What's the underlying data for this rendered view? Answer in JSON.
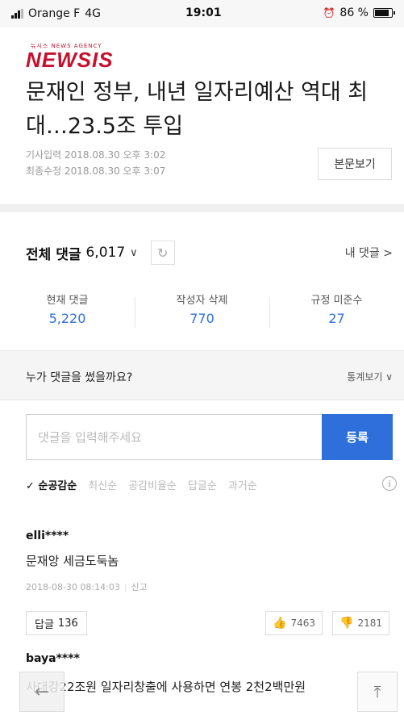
{
  "status_bar": {
    "carrier": "Orange F",
    "network": "4G",
    "time": "19:01",
    "alarm_icon": "alarm-clock-icon",
    "battery": "86 %",
    "battery_level": 0.86
  },
  "brand": {
    "logo_small": "뉴시스 NEWS AGENCY",
    "logo": "NEWSIS"
  },
  "article": {
    "headline": "문재인 정부, 내년 일자리예산 역대 최대…23.5조 투입",
    "published_label": "기사입력",
    "published": "2018.08.30 오후 3:02",
    "modified_label": "최종수정",
    "modified": "2018.08.30 오후 3:07",
    "original_button": "본문보기"
  },
  "comments_header": {
    "title": "전체 댓글",
    "count": "6,017",
    "dropdown_icon": "chevron-down-icon",
    "refresh_icon": "refresh-icon",
    "my_comments": "내 댓글 >"
  },
  "stats": [
    {
      "label": "현재 댓글",
      "value": "5,220"
    },
    {
      "label": "작성자 삭제",
      "value": "770"
    },
    {
      "label": "규정 미준수",
      "value": "27"
    }
  ],
  "who_wrote": {
    "text": "누가 댓글을 썼을까요?",
    "toggle": "통계보기 ∨"
  },
  "comment_input": {
    "placeholder": "댓글을 입력해주세요",
    "value": "",
    "submit": "등록"
  },
  "sort": {
    "active": "✓ 순공감순",
    "options": [
      "최신순",
      "공감비율순",
      "답글순",
      "과거순"
    ],
    "info_icon": "info-icon"
  },
  "comments": [
    {
      "user": "elli****",
      "text": "문재앙 세금도둑놈",
      "date": "2018-08-30 08:14:03",
      "report": "신고",
      "reply_label": "답글",
      "reply_count": "136",
      "likes": "7463",
      "dislikes": "2181"
    },
    {
      "user": "baya****",
      "text": "사대강22조원 일자리창출에 사용하면 연봉 2천2백만원"
    }
  ],
  "nav": {
    "back_icon": "arrow-left-icon",
    "top_icon": "arrow-up-to-top-icon"
  },
  "colors": {
    "brand": "#c8102e",
    "accent": "#2f6fdb",
    "like": "#f08b6c"
  }
}
